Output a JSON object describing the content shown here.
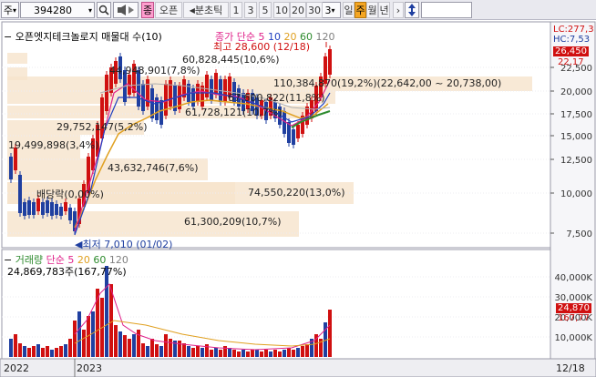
{
  "toolbar": {
    "market": "주",
    "code": "394280",
    "mode_badge": "종",
    "stock_name": "오픈",
    "interval_label": "분초틱",
    "intervals": [
      "1",
      "3",
      "5",
      "10",
      "20",
      "30"
    ],
    "period_value": "3",
    "period_units": [
      "일",
      "주",
      "월",
      "년"
    ],
    "active_unit": "주"
  },
  "price_panel": {
    "legend_title": "오픈엣지테크놀로지 매물대 수(10)",
    "ma_label": "종가 단순",
    "ma_periods": [
      "5",
      "10",
      "20",
      "60",
      "120"
    ],
    "ma_colors": [
      "#e0218a",
      "#2040c0",
      "#e0a020",
      "#2e8b2e",
      "#808080"
    ],
    "high_note": "최고 28,600 (12/18)",
    "low_note": "최저 7,010 (01/02)",
    "current_tag": "26,450",
    "lc_label": "LC:277,3",
    "hc_label": "HC:7,53",
    "side_tag": "22,17",
    "y_ticks": [
      "22,500",
      "20,000",
      "17,500",
      "15,000",
      "12,500",
      "10,000",
      "7,500"
    ],
    "volume_profile": [
      {
        "text": "60,828,445(10,6%)"
      },
      {
        "text": "44,948,901(7,8%)"
      },
      {
        "text": "110,384,870(19,2%)(22,642,00 ~ 20,738,00)"
      },
      {
        "text": "67,600,822(11,8%)"
      },
      {
        "text": "61,728,121(10,7%)"
      },
      {
        "text": "29,752,147(5,2%)"
      },
      {
        "text": "19,499,898(3,4%)"
      },
      {
        "text": "43,632,746(7,6%)"
      },
      {
        "text": "배당락(0,00%)"
      },
      {
        "text": "74,550,220(13,0%)"
      },
      {
        "text": "61,300,209(10,7%)"
      }
    ]
  },
  "volume_panel": {
    "legend_title": "거래량",
    "ma_label": "단순",
    "ma_periods": [
      "5",
      "20",
      "60",
      "120"
    ],
    "ma_colors": [
      "#e0218a",
      "#e0a020",
      "#2e8b2e",
      "#808080"
    ],
    "current_value": "24,869,783주(167,77%)",
    "current_tag": "24,870",
    "side_tag": "167,77",
    "y_ticks": [
      "40,000K",
      "30,000K",
      "20,000K",
      "10,000K"
    ]
  },
  "x_axis": {
    "labels": [
      "2022",
      "2023",
      "12/18"
    ]
  }
}
